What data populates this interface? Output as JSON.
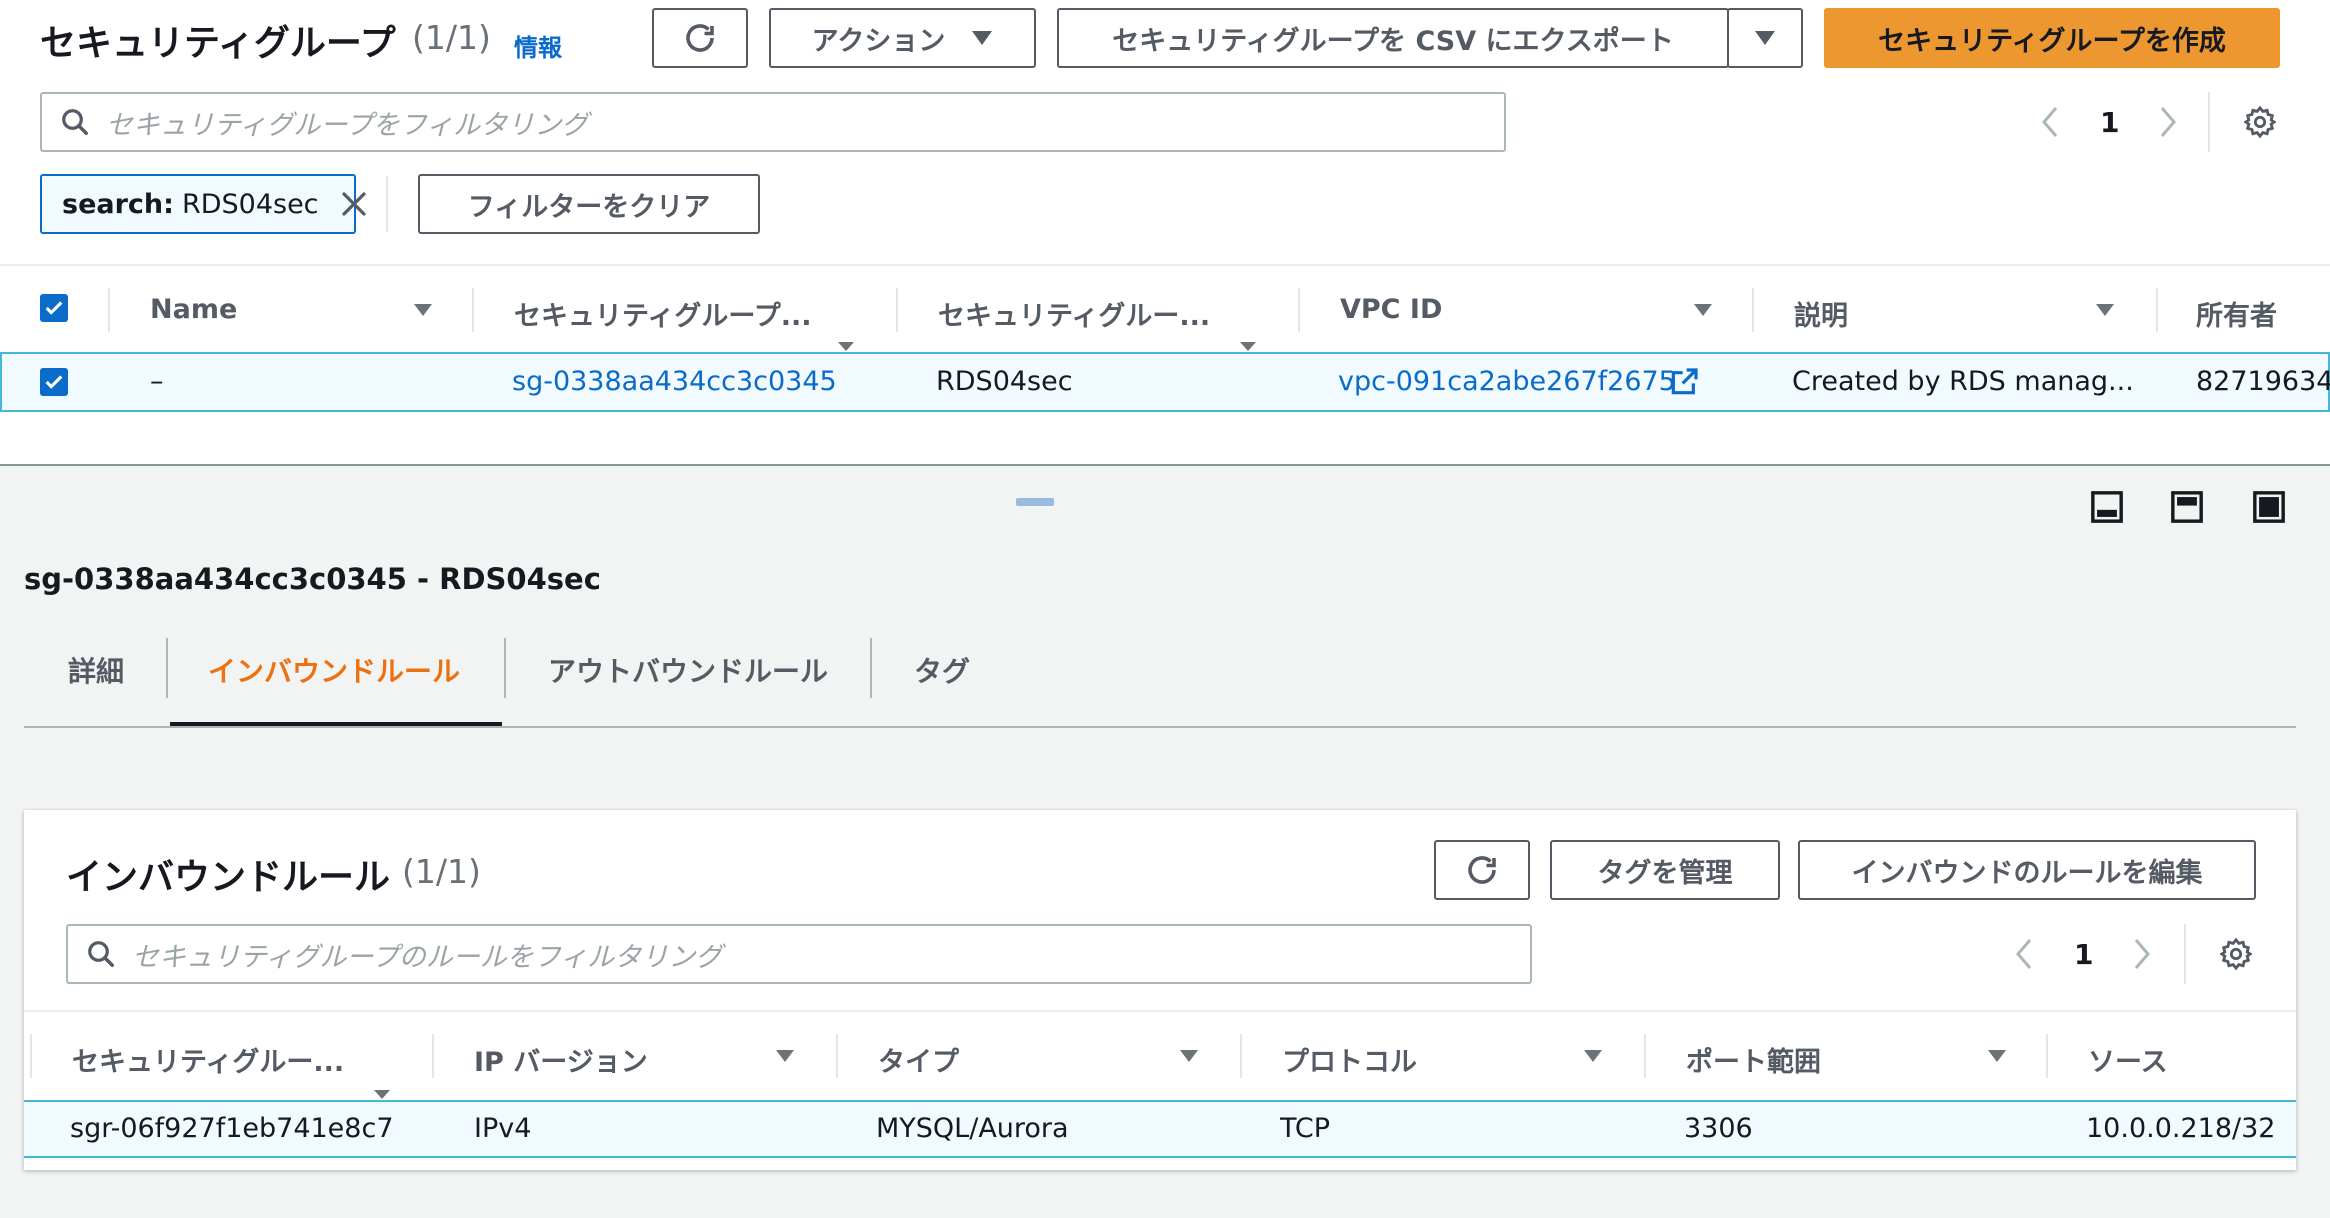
{
  "header": {
    "title": "セキュリティグループ",
    "count": "(1/1)",
    "info": "情報",
    "actions_label": "アクション",
    "export_label": "セキュリティグループを CSV にエクスポート",
    "create_label": "セキュリティグループを作成"
  },
  "search": {
    "placeholder": "セキュリティグループをフィルタリング",
    "page": "1"
  },
  "filter": {
    "token_key": "search:",
    "token_value": "RDS04sec",
    "clear_label": "フィルターをクリア"
  },
  "table": {
    "columns": [
      "Name",
      "セキュリティグループ...",
      "セキュリティグルー...",
      "VPC ID",
      "説明",
      "所有者"
    ],
    "rows": [
      {
        "name": "–",
        "group_id": "sg-0338aa434cc3c0345",
        "group_name": "RDS04sec",
        "vpc_id": "vpc-091ca2abe267f2675",
        "description": "Created by RDS manag...",
        "owner": "82719634"
      }
    ]
  },
  "detail": {
    "title": "sg-0338aa434cc3c0345 - RDS04sec",
    "tabs": [
      "詳細",
      "インバウンドルール",
      "アウトバウンドルール",
      "タグ"
    ],
    "active_tab": "インバウンドルール"
  },
  "inbound": {
    "title": "インバウンドルール",
    "count": "(1/1)",
    "manage_tags_label": "タグを管理",
    "edit_rules_label": "インバウンドのルールを編集",
    "search_placeholder": "セキュリティグループのルールをフィルタリング",
    "page": "1",
    "columns": [
      "セキュリティグルー...",
      "IP バージョン",
      "タイプ",
      "プロトコル",
      "ポート範囲",
      "ソース"
    ],
    "rows": [
      {
        "rule_id": "sgr-06f927f1eb741e8c7",
        "ip_version": "IPv4",
        "type": "MYSQL/Aurora",
        "protocol": "TCP",
        "port_range": "3306",
        "source": "10.0.0.218/32"
      }
    ]
  },
  "colors": {
    "accent": "#ec972f",
    "link": "#0a6bc8",
    "active_tab": "#ec7211",
    "selected_row_bg": "#f1faff"
  }
}
